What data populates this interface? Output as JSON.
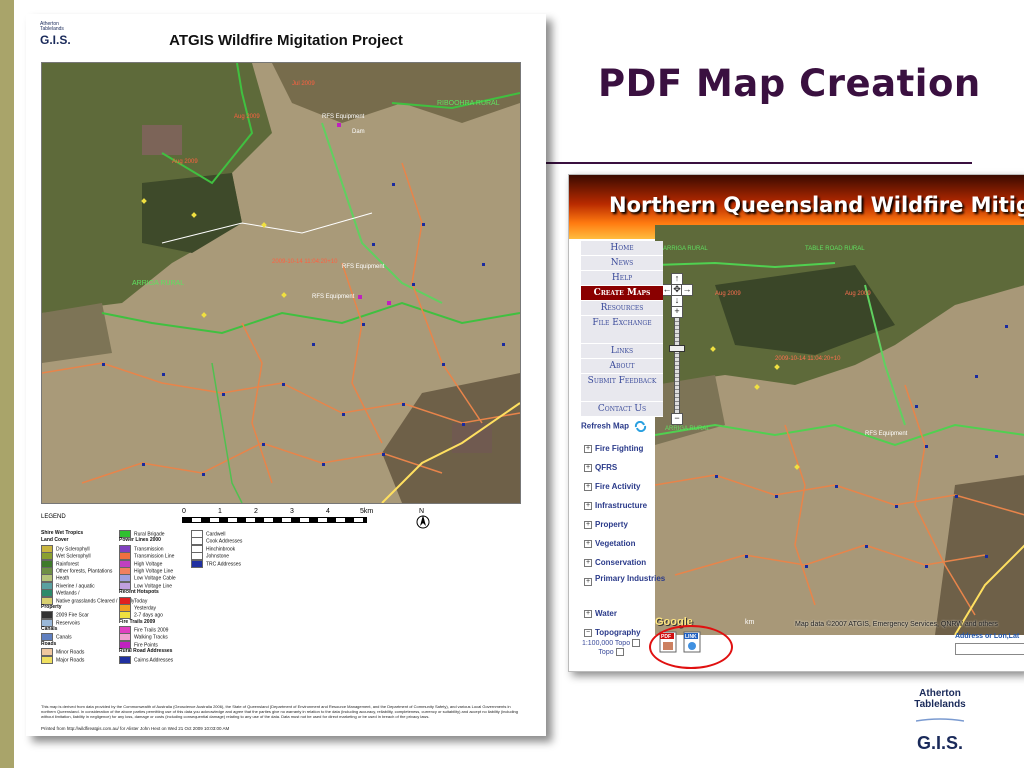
{
  "slide": {
    "title": "PDF Map Creation",
    "colors": {
      "title": "#3a1040",
      "accent_bar": "#a9a46a",
      "highlight_circle": "#e01010"
    }
  },
  "pdf": {
    "logo": {
      "line1": "Atherton",
      "line2": "Tablelands",
      "gis": "G.I.S."
    },
    "title": "ATGIS Wildfire Migitation Project",
    "map_labels": [
      "RIBOOHRA RURAL",
      "ARRIGA RURAL",
      "RFS Equipment",
      "Dam",
      "Aug 2009",
      "Jul 2009",
      "2009-10-14 11:04:20+10"
    ],
    "legend_header": "LEGEND",
    "scale": {
      "ticks": [
        "0",
        "1",
        "2",
        "3",
        "4",
        "5km"
      ]
    },
    "north": "N",
    "legend_col1": [
      {
        "label": "Shire Wet Tropics",
        "color": ""
      },
      {
        "label": "Land Cover",
        "color": ""
      },
      {
        "label": "Dry Sclerophyll",
        "color": "#c9b640"
      },
      {
        "label": "Wet Sclerophyll",
        "color": "#8aa030"
      },
      {
        "label": "Rainforest",
        "color": "#3e7a2a"
      },
      {
        "label": "Other forests, Plantations",
        "color": "#6e8f45"
      },
      {
        "label": "Heath",
        "color": "#b4c47a"
      },
      {
        "label": "Riverine / aquatic",
        "color": "#5aa0a0"
      },
      {
        "label": "Wetlands /",
        "color": "#2e8a6a"
      },
      {
        "label": "Native grasslands Cleared / heavily",
        "color": "#d8d070"
      },
      {
        "label": "Property",
        "color": ""
      },
      {
        "label": "2009 Fire Scar",
        "color": "#333333"
      },
      {
        "label": "Reservoirs",
        "color": "#9ab8d8"
      },
      {
        "label": "Canals",
        "color": ""
      },
      {
        "label": "Canals",
        "color": "#6080c0"
      },
      {
        "label": "Roads",
        "color": ""
      },
      {
        "label": "Minor Roads",
        "color": "#f0c8a0"
      },
      {
        "label": "Major Roads",
        "color": "#f0e060"
      }
    ],
    "legend_col2": [
      {
        "label": "Rural Brigade",
        "color": "#30c030"
      },
      {
        "label": "Power Lines 2000",
        "color": ""
      },
      {
        "label": "Transmission",
        "color": "#8040c0"
      },
      {
        "label": "Transmission Line",
        "color": "#f07040"
      },
      {
        "label": "High Voltage",
        "color": "#c040c0"
      },
      {
        "label": "High Voltage Line",
        "color": "#f08060"
      },
      {
        "label": "Low Voltage Cable",
        "color": "#a0a0e0"
      },
      {
        "label": "Low Voltage Line",
        "color": "#c0a0e0"
      },
      {
        "label": "Recent Hotspots",
        "color": ""
      },
      {
        "label": "Today",
        "color": "#e02020"
      },
      {
        "label": "Yesterday",
        "color": "#f0a020"
      },
      {
        "label": "2-7 days ago",
        "color": "#f0e040"
      },
      {
        "label": "Fire Trails 2009",
        "color": ""
      },
      {
        "label": "Fire Trails 2009",
        "color": "#e040c0"
      },
      {
        "label": "Walking Tracks",
        "color": "#f0a0d0"
      },
      {
        "label": "Fire Points",
        "color": "#c020c0"
      },
      {
        "label": "Rural Road Addresses",
        "color": ""
      },
      {
        "label": "Cairns Addresses",
        "color": "#2030a0"
      }
    ],
    "legend_col3": [
      {
        "label": "Cardwell",
        "color": "#ffffff"
      },
      {
        "label": "Cook Addresses",
        "color": "#ffffff"
      },
      {
        "label": "Hinchinbrook",
        "color": "#ffffff"
      },
      {
        "label": "Johnstone",
        "color": "#ffffff"
      },
      {
        "label": "TRC Addresses",
        "color": "#2030a0"
      }
    ],
    "disclaimer": "This map is derived from data provided by the Commonwealth of Australia (Geoscience Australia 2006), the State of Queensland (Department of Environment and Resource Management, and the Department of Community Safety), and various Local Governments in northern Queensland. In consideration of the above parties permitting use of this data you acknowledge and agree that the parties give no warranty in relation to the data (including accuracy, reliability, completeness, currency or suitability) and accept no liability (including without limitation, liability in negligence) for any loss, damage or costs (including consequential damage) relating to any use of the data. Data must not be used for direct marketing or be used in breach of the privacy laws.",
    "printed": "Printed from http://wildfireatgis.com.au/ for Alister John Hext on Wed 21 Oct 2009 10:03:00 AM"
  },
  "website": {
    "banner": "Northern Queensland Wildfire Mitigation Pr",
    "nav": [
      {
        "label": "Home",
        "active": false
      },
      {
        "label": "News",
        "active": false
      },
      {
        "label": "Help",
        "active": false
      },
      {
        "label": "Create Maps",
        "active": true
      },
      {
        "label": "Resources",
        "active": false
      },
      {
        "label": "File Exchange",
        "active": false
      },
      {
        "label": "Links",
        "active": false
      },
      {
        "label": "About",
        "active": false
      },
      {
        "label": "Submit Feedback",
        "active": false
      },
      {
        "label": "Contact Us",
        "active": false
      }
    ],
    "refresh_label": "Refresh Map",
    "layers": [
      {
        "label": "Fire Fighting",
        "state": "+"
      },
      {
        "label": "QFRS",
        "state": "+"
      },
      {
        "label": "Fire Activity",
        "state": "+"
      },
      {
        "label": "Infrastructure",
        "state": "+"
      },
      {
        "label": "Property",
        "state": "+"
      },
      {
        "label": "Vegetation",
        "state": "+"
      },
      {
        "label": "Conservation",
        "state": "+"
      },
      {
        "label": "Primary Industries",
        "state": "+"
      },
      {
        "label": "Water",
        "state": "+"
      },
      {
        "label": "Topography",
        "state": "−"
      }
    ],
    "topo_items": [
      "1:100,000 Topo",
      "Topo"
    ],
    "map_labels": [
      "ARRIGA RURAL",
      "TABLE ROAD RURAL",
      "RFS Equipment",
      "Aug 2009",
      "2009-10-14 11:04:20+10"
    ],
    "map_footer": {
      "google": "Google",
      "scale": "km",
      "attribution": "Map data ©2007 ATGIS, Emergency Services, QNRW and others"
    },
    "address": {
      "label": "Address or Lon,Lat",
      "value": ""
    },
    "pdf_button": "PDF",
    "link_button": "LINK"
  },
  "logo": {
    "line1": "Atherton",
    "line2": "Tablelands",
    "gis": "G.I.S."
  }
}
